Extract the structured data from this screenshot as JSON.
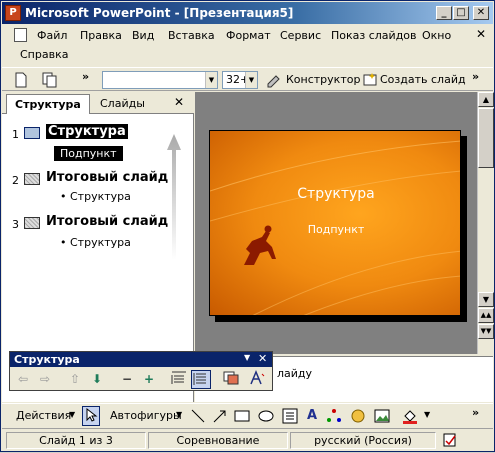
{
  "window": {
    "title": "Microsoft PowerPoint - [Презентация5]",
    "minimize": "_",
    "maximize": "□",
    "close": "✕"
  },
  "menu": {
    "items": [
      "Файл",
      "Правка",
      "Вид",
      "Вставка",
      "Формат",
      "Сервис",
      "Показ слайдов",
      "Окно",
      "Справка"
    ],
    "doc_close": "✕"
  },
  "toolbar": {
    "more": "»",
    "font_name": "",
    "font_size": "32+",
    "designer": "Конструктор",
    "new_slide": "Создать слайд"
  },
  "panel": {
    "tabs": [
      "Структура",
      "Слайды"
    ],
    "close": "✕",
    "outline": [
      {
        "num": "1",
        "title": "Структура",
        "bullet": "Подпункт"
      },
      {
        "num": "2",
        "title": "Итоговый слайд",
        "bullet": "Структура"
      },
      {
        "num": "3",
        "title": "Итоговый слайд",
        "bullet": "Структура"
      }
    ]
  },
  "slide": {
    "title": "Структура",
    "subtitle": "Подпункт"
  },
  "notes": {
    "text": "лайду"
  },
  "outline_toolbar": {
    "title": "Структура",
    "close": "✕"
  },
  "draw": {
    "actions": "Действия",
    "autoshapes": "Автофигуры"
  },
  "status": {
    "slide": "Слайд 1 из 3",
    "design": "Соревнование",
    "language": "русский (Россия)"
  },
  "colors": {
    "titlebar": "#0a246a",
    "slide_orange": "#f08a10",
    "selection": "#000000"
  }
}
